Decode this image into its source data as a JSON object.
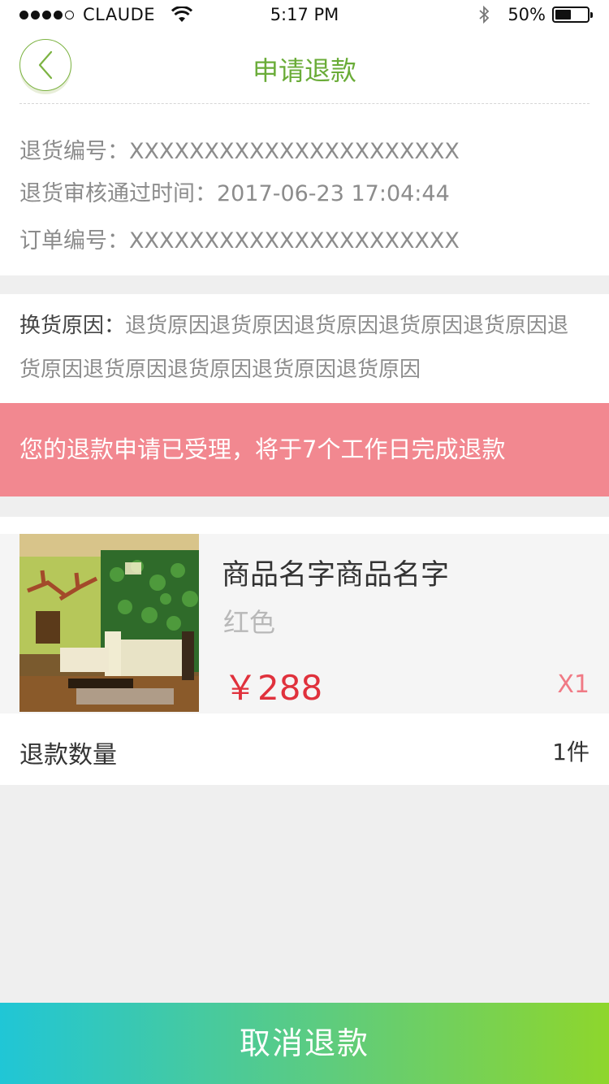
{
  "status_bar": {
    "carrier": "CLAUDE",
    "time": "5:17 PM",
    "battery_percent": "50%",
    "battery_level": 0.5,
    "signal_bars": 4,
    "signal_total": 5
  },
  "nav": {
    "title": "申请退款",
    "back_icon": "chevron-left-icon",
    "accent_color": "#6aac38"
  },
  "info": {
    "return_no_label": "退货编号：",
    "return_no_value": "XXXXXXXXXXXXXXXXXXXXXX",
    "approved_time_label": "退货审核通过时间：",
    "approved_time_value": "2017-06-23 17:04:44",
    "order_no_label": "订单编号：",
    "order_no_value": "XXXXXXXXXXXXXXXXXXXXXX"
  },
  "reason": {
    "label": "换货原因：",
    "text": "退货原因退货原因退货原因退货原因退货原因退货原因退货原因退货原因退货原因退货原因"
  },
  "notice": {
    "text": "您的退款申请已受理，将于7个工作日完成退款",
    "color": "#f28890"
  },
  "product": {
    "name": "商品名字商品名字",
    "color": "红色",
    "price": "￥288",
    "quantity": "X1"
  },
  "refund_qty": {
    "label": "退款数量",
    "value": "1件"
  },
  "bottom_button": {
    "label": "取消退款"
  }
}
